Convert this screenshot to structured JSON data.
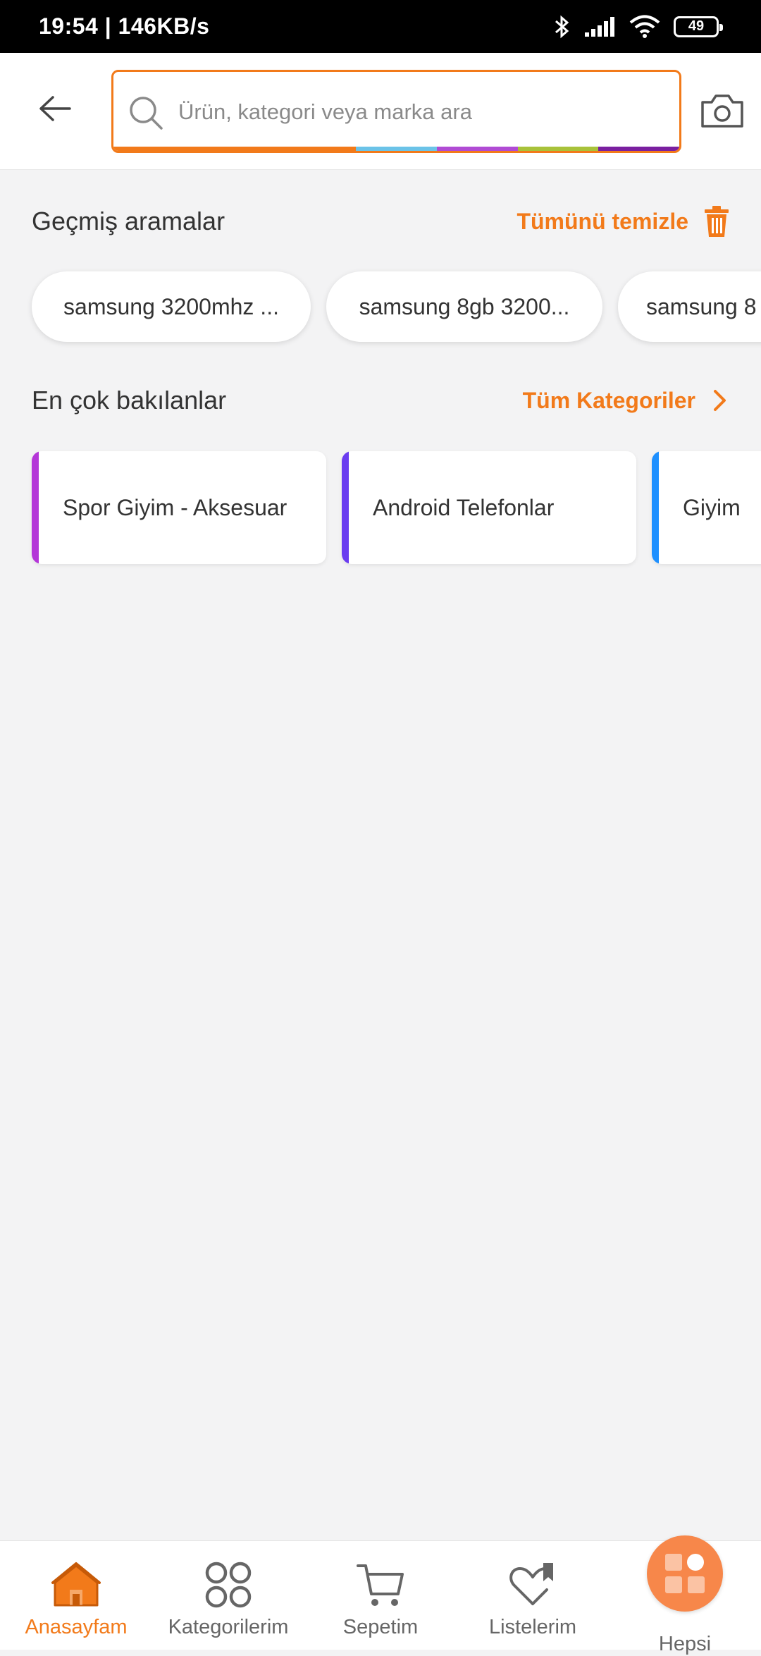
{
  "status_bar": {
    "time": "19:54 | 146KB/s",
    "battery": "49"
  },
  "header": {
    "search_placeholder": "Ürün, kategori veya marka ara",
    "rainbow_colors": [
      "#f27a1a",
      "#f27a1a",
      "#f27a1a",
      "#6bc3e8",
      "#b04bd4",
      "#a8c23a",
      "#7a1fa0"
    ]
  },
  "recent_searches": {
    "title": "Geçmiş aramalar",
    "clear_label": "Tümünü temizle",
    "items": [
      "samsung 3200mhz ...",
      "samsung 8gb 3200...",
      "samsung 8"
    ]
  },
  "most_viewed": {
    "title": "En çok bakılanlar",
    "all_categories_label": "Tüm Kategoriler",
    "items": [
      {
        "label": "Spor Giyim - Aksesuar",
        "color": "#b436d8"
      },
      {
        "label": "Android Telefonlar",
        "color": "#6a3cf0"
      },
      {
        "label": "Giyim",
        "color": "#1e90ff"
      }
    ]
  },
  "bottom_nav": {
    "items": [
      {
        "label": "Anasayfam",
        "icon": "home-icon",
        "active": true
      },
      {
        "label": "Kategorilerim",
        "icon": "categories-icon",
        "active": false
      },
      {
        "label": "Sepetim",
        "icon": "cart-icon",
        "active": false
      },
      {
        "label": "Listelerim",
        "icon": "heart-list-icon",
        "active": false
      },
      {
        "label": "Hepsi",
        "icon": "hepsi-icon",
        "active": false
      }
    ]
  },
  "colors": {
    "accent": "#f27a1a",
    "background": "#f3f3f4"
  }
}
